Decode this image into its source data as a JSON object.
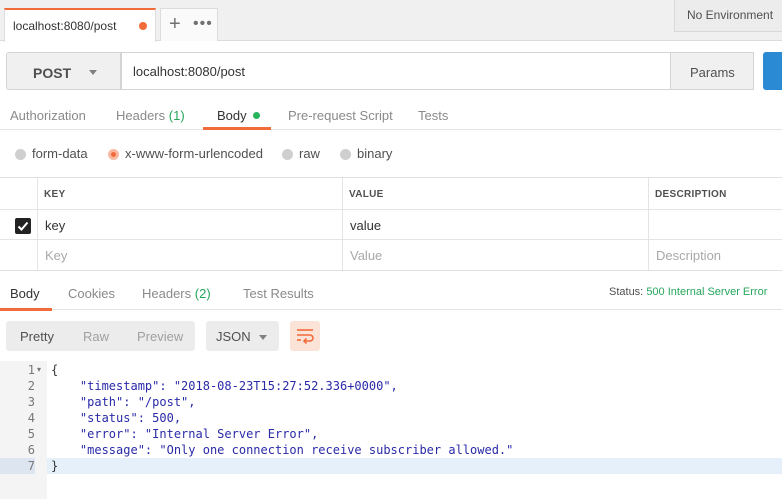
{
  "tab": {
    "title": "localhost:8080/post"
  },
  "tab_actions": {
    "add": "+",
    "more": "•••"
  },
  "environment": {
    "label": "No Environment"
  },
  "request": {
    "method": "POST",
    "url": "localhost:8080/post",
    "params_label": "Params"
  },
  "request_tabs": [
    {
      "label": "Authorization"
    },
    {
      "label": "Headers",
      "count": "(1)"
    },
    {
      "label": "Body"
    },
    {
      "label": "Pre-request Script"
    },
    {
      "label": "Tests"
    }
  ],
  "body_types": [
    {
      "label": "form-data",
      "selected": false
    },
    {
      "label": "x-www-form-urlencoded",
      "selected": true
    },
    {
      "label": "raw",
      "selected": false
    },
    {
      "label": "binary",
      "selected": false
    }
  ],
  "kv_table": {
    "headers": [
      "KEY",
      "VALUE",
      "DESCRIPTION"
    ],
    "rows": [
      {
        "key": "key",
        "value": "value",
        "checked": true
      }
    ],
    "placeholders": {
      "key": "Key",
      "value": "Value",
      "description": "Description"
    }
  },
  "response_tabs": [
    {
      "label": "Body"
    },
    {
      "label": "Cookies"
    },
    {
      "label": "Headers",
      "count": "(2)"
    },
    {
      "label": "Test Results"
    }
  ],
  "status": {
    "label": "Status:",
    "value": "500 Internal Server Error"
  },
  "format": {
    "options": [
      "Pretty",
      "Raw",
      "Preview"
    ],
    "selected": "Pretty",
    "language": "JSON"
  },
  "response_body": {
    "line_numbers": [
      "1",
      "2",
      "3",
      "4",
      "5",
      "6",
      "7"
    ],
    "lines": [
      "{",
      "    \"timestamp\": \"2018-08-23T15:27:52.336+0000\",",
      "    \"path\": \"/post\",",
      "    \"status\": 500,",
      "    \"error\": \"Internal Server Error\",",
      "    \"message\": \"Only one connection receive subscriber allowed.\"",
      "}"
    ]
  },
  "colors": {
    "accent": "#f26b3a",
    "success": "#26a65b",
    "send": "#2a8ad4"
  }
}
